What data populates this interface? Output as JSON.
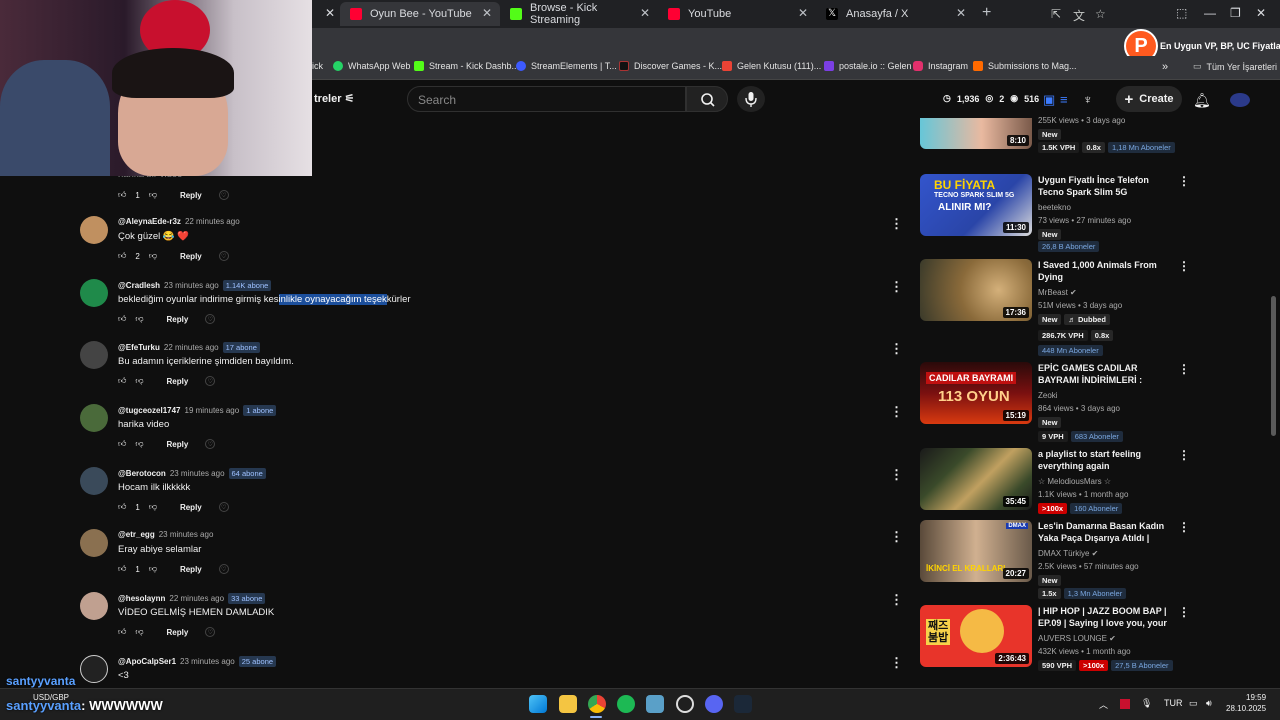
{
  "tabs": [
    {
      "label": "Oyun Bee - YouTube",
      "icon": "youtube-icon",
      "color": "#ff0033"
    },
    {
      "label": "Browse - Kick Streaming",
      "icon": "kick-icon",
      "color": "#53fc18"
    },
    {
      "label": "YouTube",
      "icon": "youtube-icon",
      "color": "#ff0033"
    },
    {
      "label": "Anasayfa / X",
      "icon": "x-icon",
      "color": "#ffffff"
    }
  ],
  "bookmarks": [
    {
      "label": "ick",
      "color": "#53fc18"
    },
    {
      "label": "WhatsApp Web",
      "color": "#25d366"
    },
    {
      "label": "Stream - Kick Dashb...",
      "color": "#53fc18"
    },
    {
      "label": "StreamElements | T...",
      "color": "#3d5afe"
    },
    {
      "label": "Discover Games - K...",
      "color": "#000000"
    },
    {
      "label": "Gelen Kutusu (111)...",
      "color": "#ea4335"
    },
    {
      "label": "postale.io :: Gelen",
      "color": "#7b3fe4"
    },
    {
      "label": "Instagram",
      "color": "#e1306c"
    },
    {
      "label": "Submissions to Mag...",
      "color": "#ff6a00"
    }
  ],
  "all_bookmarks": "Tüm Yer İşaretleri",
  "profile": {
    "letter": "P",
    "text": "En Uygun VP, BP, UC Fiyatları!"
  },
  "header": {
    "filters_label": "treler",
    "search_placeholder": "Search",
    "stats": {
      "clock": "1,936",
      "views": "2",
      "eye": "516"
    },
    "create_label": "Create"
  },
  "comments": [
    {
      "user": "",
      "time": "",
      "badge": "",
      "text": "harika bir video",
      "likes": "1",
      "avatar": "#8a6a5a"
    },
    {
      "user": "@AleynaEde-r3z",
      "time": "22 minutes ago",
      "badge": "",
      "text": "Çok güzel 😂 ❤️",
      "likes": "2",
      "avatar": "#c09060"
    },
    {
      "user": "@Cradlesh",
      "time": "23 minutes ago",
      "badge": "1.14K abone",
      "text_before": "beklediğim oyunlar indirime girmiş kes",
      "text_highlight": "inlikle oynayacağım teşek",
      "text_after": "kürler",
      "likes": "",
      "avatar": "#1f8a4a"
    },
    {
      "user": "@EfeTurku",
      "time": "22 minutes ago",
      "badge": "17 abone",
      "text": "Bu adamın içeriklerine şimdiden bayıldım.",
      "likes": "",
      "avatar": "#444444"
    },
    {
      "user": "@tugceozel1747",
      "time": "19 minutes ago",
      "badge": "1 abone",
      "text": "harika video",
      "likes": "",
      "avatar": "#4a6a3a"
    },
    {
      "user": "@Berotocon",
      "time": "23 minutes ago",
      "badge": "64 abone",
      "text": "Hocam ilk ilkkkkk",
      "likes": "1",
      "avatar": "#3a4a5a"
    },
    {
      "user": "@etr_egg",
      "time": "23 minutes ago",
      "badge": "",
      "text": "Eray abiye selamlar",
      "likes": "1",
      "avatar": "#8a7050"
    },
    {
      "user": "@hesolaynn",
      "time": "22 minutes ago",
      "badge": "33 abone",
      "text": "VİDEO GELMİŞ HEMEN DAMLADIK",
      "likes": "",
      "avatar": "#c0a090"
    },
    {
      "user": "@ApoCalpSer1",
      "time": "23 minutes ago",
      "badge": "25 abone",
      "text": "<3",
      "likes": "",
      "avatar": "#222222"
    }
  ],
  "reply_label": "Reply",
  "videos": [
    {
      "title": "",
      "channel": "",
      "meta": "255K views • 3 days ago",
      "duration": "8:10",
      "new": "New",
      "vph": "1.5K VPH",
      "ratio": "0.8x",
      "subs": "1,18 Mn Aboneler",
      "colors": [
        "#66c6d8",
        "#e9b9a0"
      ]
    },
    {
      "title": "Uygun Fiyatlı İnce Telefon Tecno Spark Slim 5G",
      "channel": "beetekno",
      "meta": "73 views • 27 minutes ago",
      "duration": "11:30",
      "new": "New",
      "vph": "",
      "ratio": "",
      "subs": "26,8 B Aboneler",
      "colors": [
        "#3355cc",
        "#ffd400"
      ],
      "thumb_text": "BU FİYATA TECNO SPARK SLIM 5G ALINIR MI?"
    },
    {
      "title": "I Saved 1,000 Animals From Dying",
      "channel": "MrBeast",
      "meta": "51M views • 3 days ago",
      "duration": "17:36",
      "new": "New",
      "dubbed": "Dubbed",
      "vph": "286.7K VPH",
      "ratio": "0.8x",
      "subs": "448 Mn Aboneler",
      "colors": [
        "#8a6a3a",
        "#d4b07a"
      ]
    },
    {
      "title": "EPİC GAMES CADILAR BAYRAMI İNDİRİMLERİ : AKICI...",
      "channel": "Zeoki",
      "meta": "864 views • 3 days ago",
      "duration": "15:19",
      "new": "New",
      "vph": "9 VPH",
      "ratio": "",
      "subs": "683 Aboneler",
      "colors": [
        "#7a1010",
        "#d93a10"
      ],
      "thumb_text": "CADILAR BAYRAMI 113 OYUN"
    },
    {
      "title": "a playlist to start feeling everything again",
      "channel": "☆ MelodiousMars ☆",
      "meta": "1.1K views • 1 month ago",
      "duration": "35:45",
      "new": "",
      "vph": "",
      "ratio": ">100x",
      "subs": "160 Aboneler",
      "colors": [
        "#3a4a2a",
        "#c0a060"
      ]
    },
    {
      "title": "Les'in Damarına Basan Kadın Yaka Paça Dışarıya Atıldı | İkin...",
      "channel": "DMAX Türkiye",
      "meta": "2.5K views • 57 minutes ago",
      "duration": "20:27",
      "new": "New",
      "vph": "",
      "ratio": "1.5x",
      "subs": "1,3 Mn Aboneler",
      "colors": [
        "#5a4a3a",
        "#d0b090"
      ],
      "thumb_text": "İKİNCİ EL KRALLARI"
    },
    {
      "title": "| HIP HOP | JAZZ BOOM BAP | EP.09 | Saying I love you, your ...",
      "channel": "AUVERS LOUNGE",
      "meta": "432K views • 1 month ago",
      "duration": "2:36:43",
      "new": "",
      "vph": "590 VPH",
      "ratio": ">100x",
      "subs": "27,5 B Aboneler",
      "colors": [
        "#e8342a",
        "#f7d24a"
      ],
      "thumb_text": "째즈 붐밥"
    }
  ],
  "stream": {
    "name": "santyyvanta",
    "message_user": "santyyvanta",
    "message": ": WWWWWW"
  },
  "taskbar": {
    "currency": "USD/GBP",
    "lang": "TUR",
    "time": "19:59",
    "date": "28.10.2025"
  }
}
